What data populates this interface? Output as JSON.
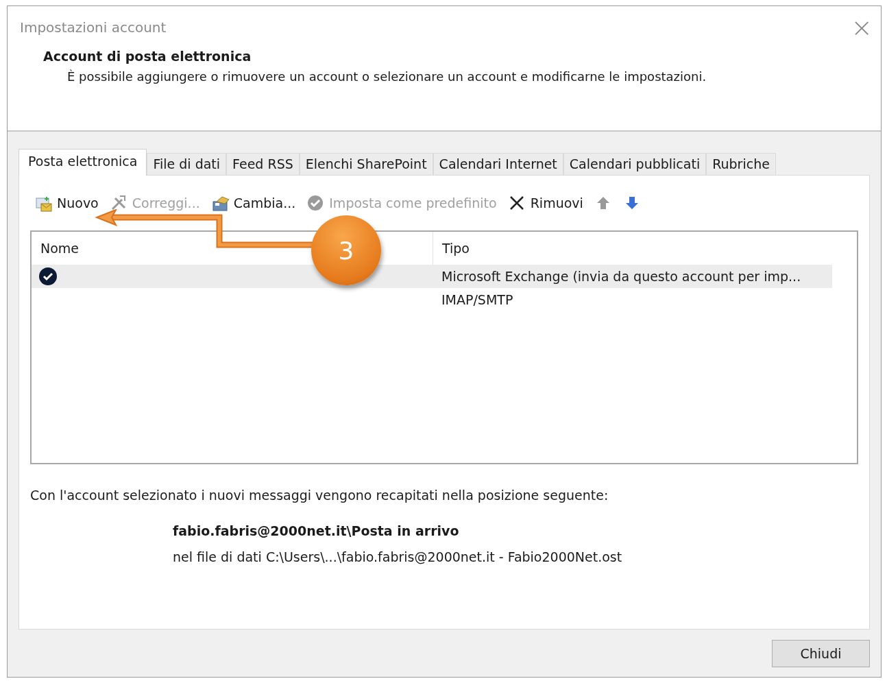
{
  "window": {
    "title": "Impostazioni account",
    "close": "×"
  },
  "header": {
    "title": "Account di posta elettronica",
    "description": "È possibile aggiungere o rimuovere un account o selezionare un account e modificarne le impostazioni."
  },
  "tabs": [
    {
      "label": "Posta elettronica",
      "selected": true
    },
    {
      "label": "File di dati",
      "selected": false
    },
    {
      "label": "Feed RSS",
      "selected": false
    },
    {
      "label": "Elenchi SharePoint",
      "selected": false
    },
    {
      "label": "Calendari Internet",
      "selected": false
    },
    {
      "label": "Calendari pubblicati",
      "selected": false
    },
    {
      "label": "Rubriche",
      "selected": false
    }
  ],
  "toolbar": [
    {
      "kind": "new",
      "label": "Nuovo",
      "disabled": false
    },
    {
      "kind": "repair",
      "label": "Correggi...",
      "disabled": true
    },
    {
      "kind": "change",
      "label": "Cambia...",
      "disabled": false
    },
    {
      "kind": "default",
      "label": "Imposta come predefinito",
      "disabled": true
    },
    {
      "kind": "remove",
      "label": "Rimuovi",
      "disabled": false
    },
    {
      "kind": "up",
      "disabled": true
    },
    {
      "kind": "down",
      "disabled": false
    }
  ],
  "table": {
    "columns": [
      "Nome",
      "Tipo"
    ],
    "rows": [
      {
        "default": true,
        "selected": true,
        "type": "Microsoft Exchange (invia da questo account per imp..."
      },
      {
        "default": false,
        "selected": false,
        "type": "IMAP/SMTP"
      }
    ]
  },
  "delivery": {
    "intro": "Con l'account selezionato i nuovi messaggi vengono recapitati nella posizione seguente:",
    "folder": "fabio.fabris@2000net.it\\Posta in arrivo",
    "file": "nel file di dati C:\\Users\\...\\fabio.fabris@2000net.it - Fabio2000Net.ost"
  },
  "buttons": [
    "Chiudi"
  ],
  "callout": {
    "number": "3"
  }
}
